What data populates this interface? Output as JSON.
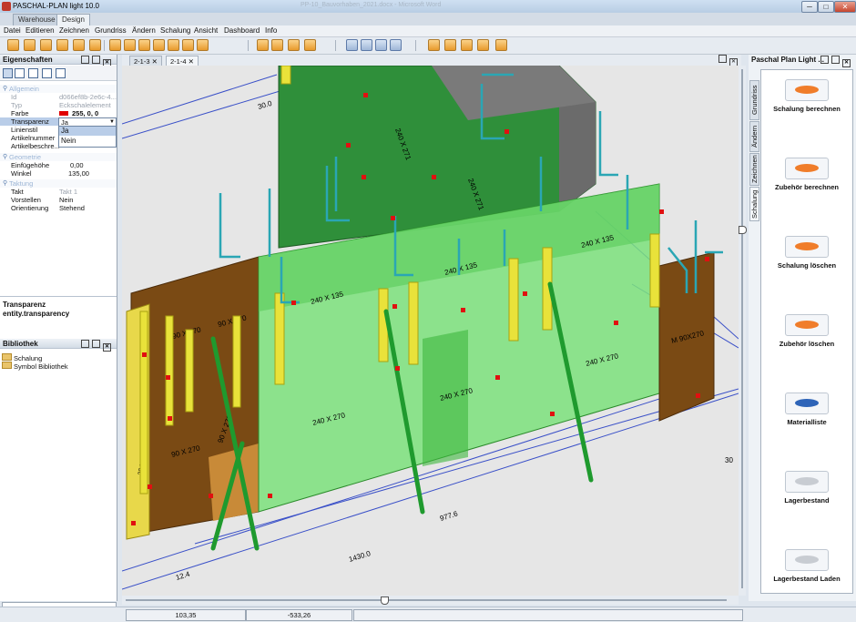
{
  "window": {
    "title": "PASCHAL-PLAN light 10.0",
    "ghost_title": "PP-10_Bauvorhaben_2021.docx - Microsoft Word",
    "minimize": "─",
    "maximize": "□",
    "close": "✕"
  },
  "app_tabs": [
    "Warehouse",
    "Design"
  ],
  "menu": [
    "Datei",
    "Editieren",
    "Zeichnen",
    "Grundriss",
    "Ändern",
    "Schalung",
    "Ansicht",
    "Dashboard",
    "Info"
  ],
  "toolbar_icons": [
    "new-icon",
    "delete-icon",
    "print-icon",
    "cube-icon",
    "undo-icon",
    "redo-icon",
    "cube-view-icon",
    "zoom-in-icon",
    "zoom-out-icon",
    "zoom-window-icon",
    "zoom-fit-icon",
    "layout-1-icon",
    "layout-2-icon",
    "layout-4-icon",
    "layout-grid-icon",
    "save-icon",
    "list-icon",
    "wall-icon",
    "image-icon",
    "elevation-icon"
  ],
  "properties": {
    "title": "Eigenschaften",
    "groups": [
      {
        "name": "Allgemein",
        "rows": [
          {
            "key": "Id",
            "value": "d066ef8b-2e6c-4..."
          },
          {
            "key": "Typ",
            "value": "Eckschalelement"
          },
          {
            "key": "Farbe",
            "value": "255, 0, 0",
            "color": "#e00000"
          },
          {
            "key": "Transparenz",
            "value": "Ja"
          },
          {
            "key": "Linienstil",
            "value": ""
          },
          {
            "key": "Artikelnummer",
            "value": ""
          },
          {
            "key": "Artikelbeschre...",
            "value": ""
          }
        ]
      },
      {
        "name": "Geometrie",
        "rows": [
          {
            "key": "Einfügehöhe",
            "value": "0,00"
          },
          {
            "key": "Winkel",
            "value": "135,00"
          }
        ]
      },
      {
        "name": "Taktung",
        "rows": [
          {
            "key": "Takt",
            "value": "Takt 1"
          },
          {
            "key": "Vorstellen",
            "value": "Nein"
          },
          {
            "key": "Orientierung",
            "value": "Stehend"
          }
        ]
      }
    ],
    "dropdown_options": [
      "Ja",
      "Nein"
    ]
  },
  "description": {
    "title": "Transparenz",
    "body": "entity.transparency"
  },
  "library": {
    "title": "Bibliothek",
    "items": [
      "Schalung",
      "Symbol Bibliothek"
    ]
  },
  "view_tabs": [
    "2-1-3",
    "2-1-4"
  ],
  "scene": {
    "labels": {
      "w1": "240 X 135",
      "w2": "240 X 135",
      "w3": "240 X 135",
      "w4": "240 X 270",
      "w5": "240 X 270",
      "w6": "240 X 270",
      "w7": "90 X 270",
      "w8": "90 X 270",
      "w9": "90 X 270",
      "w10": "90 X 270",
      "w11": "M 90X270",
      "w12": "30 X 270",
      "w13": "240 X 271",
      "w14": "240 X 271"
    },
    "dimensions": {
      "d1": "30.0",
      "d2": "977.6",
      "d3": "1430.0",
      "d4": "12.4",
      "d5": "30"
    }
  },
  "right_panel": {
    "title": "Paschal Plan Light ...",
    "side_tabs": [
      "Grundriss",
      "Ändern",
      "Zeichnen",
      "Schalung"
    ],
    "buttons": [
      {
        "label": "Schalung berechnen",
        "color": "#f07d2a"
      },
      {
        "label": "Zubehör berechnen",
        "color": "#f07d2a"
      },
      {
        "label": "Schalung löschen",
        "color": "#f07d2a"
      },
      {
        "label": "Zubehör löschen",
        "color": "#f07d2a"
      },
      {
        "label": "Materialliste",
        "color": "#2e64b8"
      },
      {
        "label": "Lagerbestand",
        "color": "#c8ccd2"
      },
      {
        "label": "Lagerbestand Laden",
        "color": "#c8ccd2"
      }
    ]
  },
  "status": {
    "x": "103,35",
    "y": "-533,26"
  }
}
